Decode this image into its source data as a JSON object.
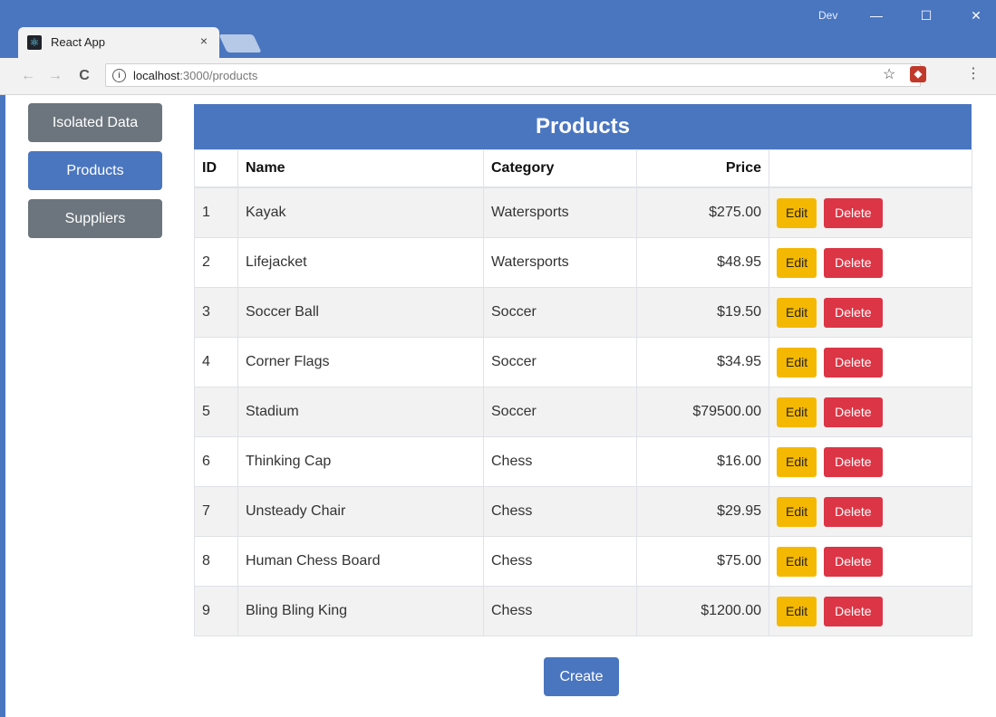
{
  "browser": {
    "tab_title": "React App",
    "tab_close": "×",
    "profile": "Dev",
    "url_host": "localhost",
    "url_path": ":3000/products",
    "window_controls": {
      "minimize": "—",
      "maximize": "☐",
      "close": "✕"
    },
    "nav": {
      "back": "←",
      "forward": "→",
      "reload": "C"
    },
    "icons": {
      "star": "☆",
      "menu": "⋮",
      "info": "i"
    }
  },
  "sidebar": {
    "items": [
      {
        "label": "Isolated Data",
        "variant": "secondary"
      },
      {
        "label": "Products",
        "variant": "primary"
      },
      {
        "label": "Suppliers",
        "variant": "secondary"
      }
    ]
  },
  "table": {
    "title": "Products",
    "columns": [
      "ID",
      "Name",
      "Category",
      "Price"
    ],
    "rows": [
      {
        "id": "1",
        "name": "Kayak",
        "category": "Watersports",
        "price": "$275.00"
      },
      {
        "id": "2",
        "name": "Lifejacket",
        "category": "Watersports",
        "price": "$48.95"
      },
      {
        "id": "3",
        "name": "Soccer Ball",
        "category": "Soccer",
        "price": "$19.50"
      },
      {
        "id": "4",
        "name": "Corner Flags",
        "category": "Soccer",
        "price": "$34.95"
      },
      {
        "id": "5",
        "name": "Stadium",
        "category": "Soccer",
        "price": "$79500.00"
      },
      {
        "id": "6",
        "name": "Thinking Cap",
        "category": "Chess",
        "price": "$16.00"
      },
      {
        "id": "7",
        "name": "Unsteady Chair",
        "category": "Chess",
        "price": "$29.95"
      },
      {
        "id": "8",
        "name": "Human Chess Board",
        "category": "Chess",
        "price": "$75.00"
      },
      {
        "id": "9",
        "name": "Bling Bling King",
        "category": "Chess",
        "price": "$1200.00"
      }
    ],
    "edit_label": "Edit",
    "delete_label": "Delete"
  },
  "create_label": "Create",
  "colors": {
    "primary": "#4a76c0",
    "secondary": "#6c757d",
    "warning": "#f5b800",
    "danger": "#dc3545"
  }
}
